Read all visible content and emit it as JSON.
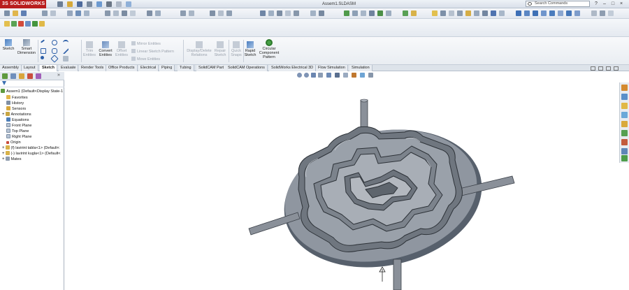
{
  "titlebar": {
    "logo": "3S SOLIDWORKS",
    "document": "Assem1.SLDASM",
    "search_placeholder": "Search Commands",
    "help": "?",
    "minimize": "–",
    "maximize": "□",
    "close": "×"
  },
  "command_manager": {
    "sketch": "Sketch",
    "smart_dimension": [
      "Smart",
      "Dimension"
    ],
    "trim": [
      "Trim",
      "Entities"
    ],
    "convert": [
      "Convert",
      "Entities"
    ],
    "offset": [
      "Offset",
      "Entities"
    ],
    "mirror": "Mirror Entities",
    "linear_pattern": "Linear Sketch Pattern",
    "move": "Move Entities",
    "display_delete": [
      "Display/Delete",
      "Relations"
    ],
    "repair": [
      "Repair",
      "Sketch"
    ],
    "quick_snaps": [
      "Quick",
      "Snaps"
    ],
    "rapid_sketch": [
      "Rapid",
      "Sketch"
    ],
    "circular_pattern": [
      "Circular",
      "Component",
      "Pattern"
    ]
  },
  "tabs": [
    "Assembly",
    "Layout",
    "Sketch",
    "Evaluate",
    "Render Tools",
    "Office Products",
    "Electrical",
    "Piping",
    "Tubing",
    "SolidCAM Part",
    "SolidCAM Operations",
    "SolidWorks Electrical 3D",
    "Flow Simulation",
    "Simulation"
  ],
  "active_tab": "Sketch",
  "feature_tree": {
    "root": "Assem1  (Default<Display State-1",
    "items": [
      "Favorites",
      "History",
      "Sensors",
      "Annotations",
      "Equations",
      "Front Plane",
      "Top Plane",
      "Right Plane",
      "Origin",
      "(f) lavirint tabla<1> (Default<",
      "(-) lavirint kugla<1> (Default<",
      "Mates"
    ]
  },
  "colors": {
    "brand": "#b91d1d",
    "model_fill": "#8d929a",
    "model_dark": "#4f545c",
    "model_light": "#c8ccd2"
  }
}
